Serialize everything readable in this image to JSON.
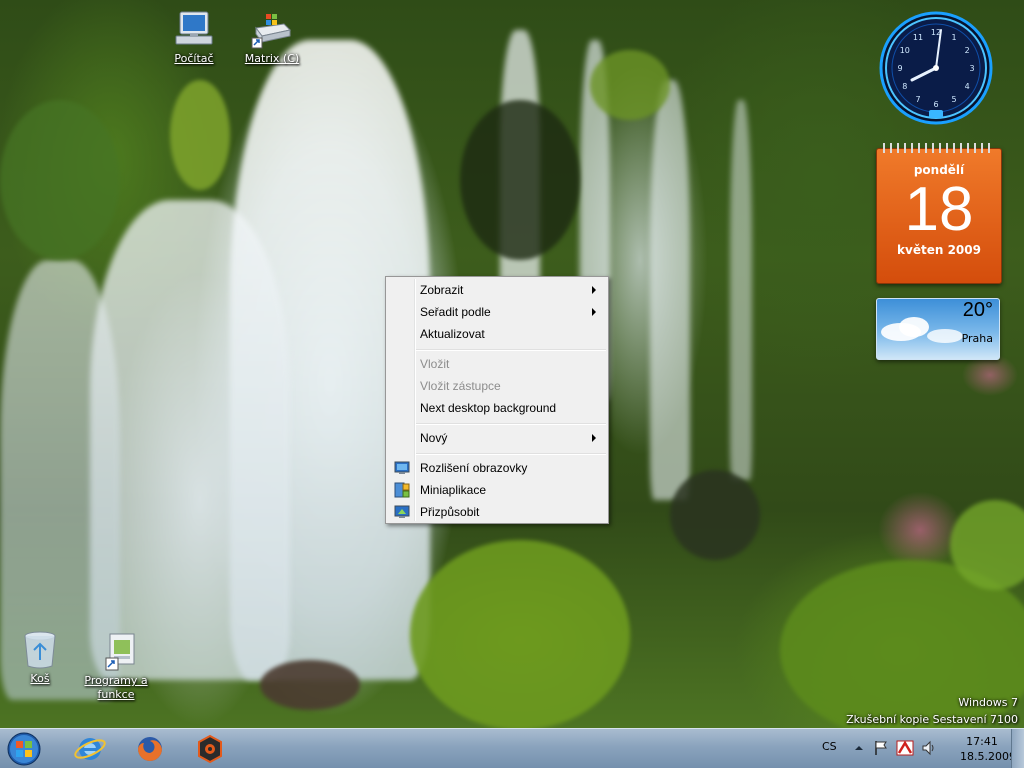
{
  "desktop": {
    "icons": [
      {
        "label": "Počítač"
      },
      {
        "label": "Matrix (C)"
      },
      {
        "label": "Koš"
      },
      {
        "label": "Programy a funkce"
      }
    ]
  },
  "gadgets": {
    "clock": {
      "time": "17:41",
      "numbers": [
        "12",
        "1",
        "2",
        "3",
        "4",
        "5",
        "6",
        "7",
        "8",
        "9",
        "10",
        "11"
      ]
    },
    "calendar": {
      "weekday": "pondělí",
      "day": "18",
      "month_year": "květen 2009"
    },
    "weather": {
      "temperature": "20°",
      "city": "Praha"
    }
  },
  "context_menu": {
    "items": [
      {
        "label": "Zobrazit",
        "submenu": true,
        "enabled": true
      },
      {
        "label": "Seřadit podle",
        "submenu": true,
        "enabled": true
      },
      {
        "label": "Aktualizovat",
        "enabled": true
      },
      {
        "label": "Vložit",
        "enabled": false
      },
      {
        "label": "Vložit zástupce",
        "enabled": false
      },
      {
        "label": "Next desktop background",
        "enabled": true
      },
      {
        "label": "Nový",
        "submenu": true,
        "enabled": true
      },
      {
        "label": "Rozlišení obrazovky",
        "icon": "display-icon",
        "enabled": true
      },
      {
        "label": "Miniaplikace",
        "icon": "gadgets-icon",
        "enabled": true
      },
      {
        "label": "Přizpůsobit",
        "icon": "personalize-icon",
        "enabled": true
      }
    ]
  },
  "watermark": {
    "line1": "Windows 7",
    "line2": "Zkušební kopie Sestavení 7100"
  },
  "taskbar": {
    "pinned": [
      "internet-explorer-icon",
      "firefox-icon",
      "reason-icon"
    ],
    "language": "CS",
    "clock_time": "17:41",
    "clock_date": "18.5.2009"
  },
  "colors": {
    "taskbar": "#8aa3bd",
    "menu_background": "#f0f0f0",
    "calendar_orange": "#e3611a",
    "disabled_text": "#8d8d8d"
  }
}
